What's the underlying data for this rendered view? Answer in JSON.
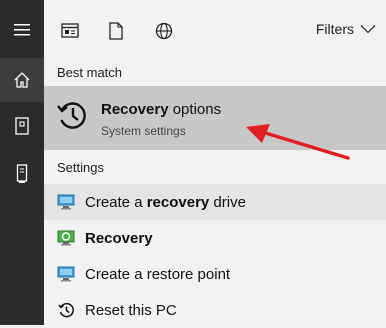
{
  "filters": {
    "label": "Filters"
  },
  "best_match": {
    "heading": "Best match",
    "title_bold": "Recovery",
    "title_rest": " options",
    "subtitle": "System settings"
  },
  "settings": {
    "heading": "Settings",
    "items": [
      {
        "pre": "Create a ",
        "bold": "recovery",
        "post": " drive",
        "icon": "monitor-icon"
      },
      {
        "pre": "",
        "bold": "Recovery",
        "post": "",
        "icon": "recovery-shield-icon"
      },
      {
        "pre": "Create a restore point",
        "bold": "",
        "post": "",
        "icon": "monitor-icon"
      },
      {
        "pre": "Reset this PC",
        "bold": "",
        "post": "",
        "icon": "history-icon"
      }
    ]
  },
  "colors": {
    "rail": "#2b2b2b",
    "panel": "#f2f2f2",
    "best_match_bg": "#c8c8c8",
    "arrow": "#e02020"
  }
}
